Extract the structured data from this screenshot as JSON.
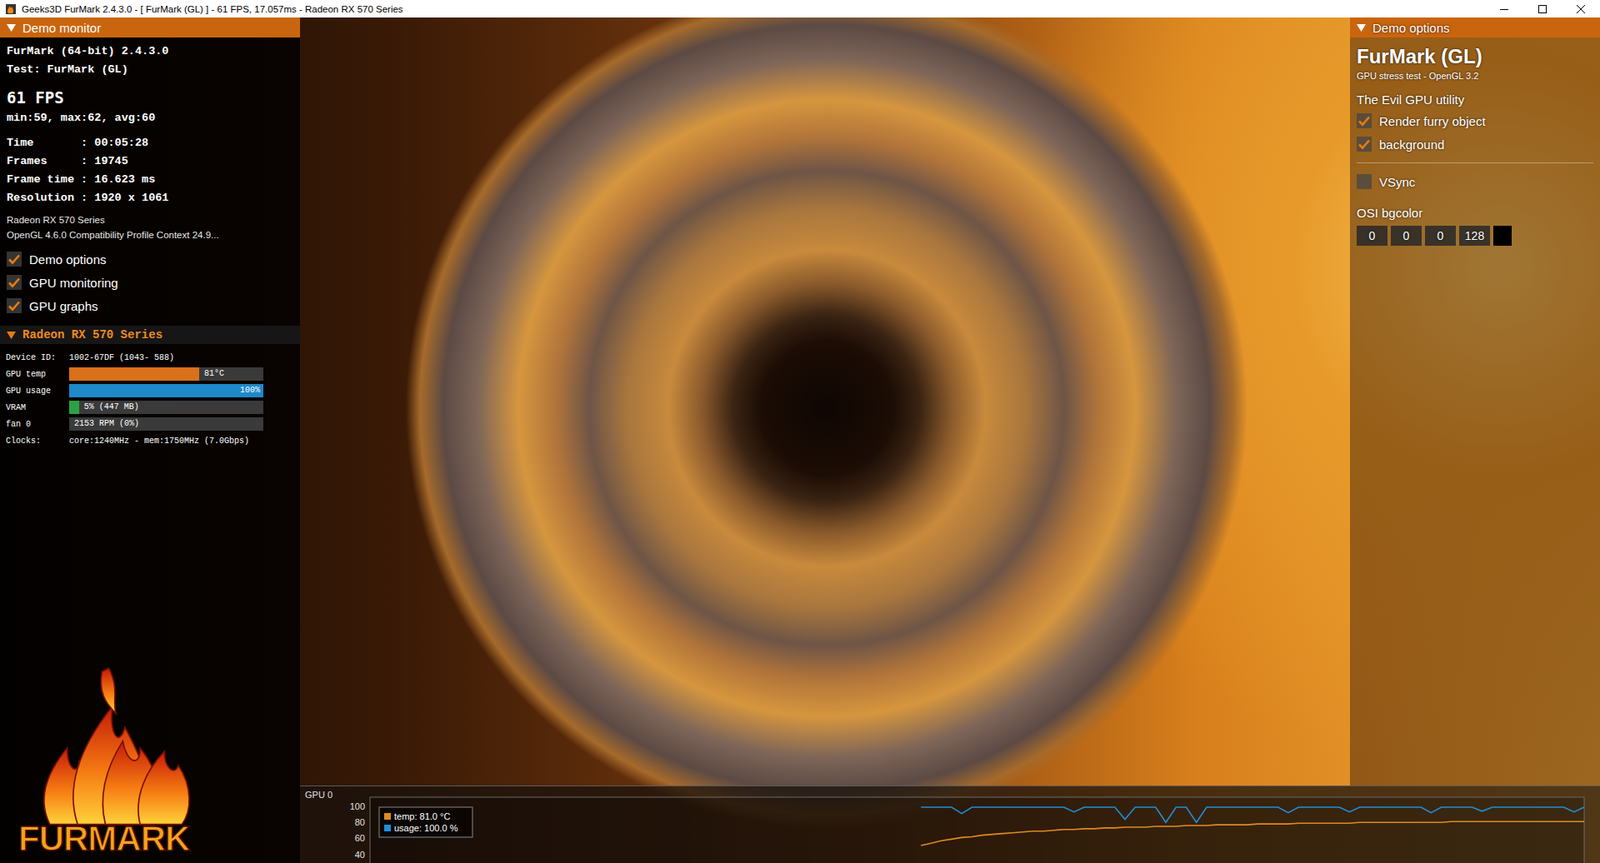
{
  "window": {
    "title": "Geeks3D FurMark 2.4.3.0 - [ FurMark (GL) ] - 61 FPS, 17.057ms - Radeon RX 570 Series"
  },
  "monitor": {
    "header": "Demo monitor",
    "expanded": true,
    "version": "FurMark (64-bit) 2.4.3.0",
    "test": "Test: FurMark (GL)",
    "fps": "61 FPS",
    "fps_stats": "min:59, max:62, avg:60",
    "stats": [
      "Time       : 00:05:28",
      "Frames     : 19745",
      "Frame time : 16.623 ms",
      "Resolution : 1920 x 1061"
    ],
    "gpu_name": "Radeon RX 570 Series",
    "gl": "OpenGL 4.6.0 Compatibility Profile Context 24.9...",
    "toggles": [
      {
        "label": "Demo options",
        "checked": true
      },
      {
        "label": "GPU monitoring",
        "checked": true
      },
      {
        "label": "GPU graphs",
        "checked": true
      }
    ]
  },
  "gpu": {
    "header": "Radeon RX 570 Series",
    "expanded": true,
    "rows": [
      {
        "kind": "text",
        "label": "Device ID:",
        "value": "1002-67DF (1043- 588)"
      },
      {
        "kind": "bar",
        "label": "GPU temp",
        "value": "81°C",
        "level": 0.67,
        "color": "#d9701a"
      },
      {
        "kind": "bar",
        "label": "GPU usage",
        "value": "100%",
        "level": 1.0,
        "color": "#1e88c8"
      },
      {
        "kind": "bar",
        "label": "VRAM",
        "value": "5% (447 MB)",
        "level": 0.05,
        "color": "#2ea043"
      },
      {
        "kind": "bar",
        "label": "fan 0",
        "value": "2153 RPM (0%)",
        "level": 0.0,
        "color": "#7a7a7a"
      },
      {
        "kind": "text",
        "label": "Clocks:",
        "value": "core:1240MHz - mem:1750MHz (7.0Gbps)"
      }
    ]
  },
  "logo": {
    "text": "FURMARK"
  },
  "options": {
    "header": "Demo options",
    "expanded": true,
    "title": "FurMark (GL)",
    "subtitle": "GPU stress test - OpenGL 3.2",
    "tagline": "The Evil GPU utility",
    "toggle_groups": [
      [
        {
          "label": "Render furry object",
          "checked": true
        },
        {
          "label": "background",
          "checked": true
        }
      ],
      [
        {
          "label": "VSync",
          "checked": false
        }
      ]
    ],
    "osi": {
      "label": "OSI bgcolor",
      "fields": [
        "0",
        "0",
        "0",
        "128"
      ],
      "swatch": "#000000"
    }
  },
  "graph": {
    "label": "GPU 0",
    "y_ticks": [
      "100",
      "80",
      "60",
      "40"
    ],
    "window_samples": 120,
    "series": [
      {
        "name": "temp",
        "legend": "temp: 81.0 °C",
        "color": "#e08a20",
        "values": [
          51,
          54,
          57,
          59,
          61,
          62,
          64,
          65,
          66,
          67,
          68,
          69,
          69,
          70,
          71,
          71,
          72,
          72,
          73,
          73,
          74,
          74,
          74,
          75,
          75,
          75,
          76,
          76,
          76,
          77,
          77,
          77,
          77,
          78,
          78,
          78,
          78,
          79,
          79,
          79,
          79,
          79,
          79,
          80,
          80,
          80,
          80,
          80,
          80,
          80,
          80,
          80,
          81,
          81,
          81,
          81,
          81,
          81,
          81,
          81,
          81,
          81,
          81,
          81,
          81,
          81
        ]
      },
      {
        "name": "usage",
        "legend": "usage: 100.0 %",
        "color": "#1e8fd6",
        "values": [
          99,
          99,
          99,
          99,
          91,
          99,
          99,
          99,
          99,
          99,
          99,
          99,
          99,
          99,
          99,
          93,
          99,
          99,
          99,
          99,
          84,
          99,
          99,
          99,
          80,
          99,
          99,
          80,
          99,
          99,
          99,
          99,
          99,
          99,
          99,
          99,
          92,
          99,
          99,
          99,
          99,
          99,
          93,
          99,
          99,
          99,
          99,
          99,
          99,
          99,
          92,
          99,
          99,
          99,
          99,
          94,
          99,
          99,
          99,
          99,
          99,
          99,
          99,
          99,
          93,
          99
        ]
      }
    ]
  }
}
